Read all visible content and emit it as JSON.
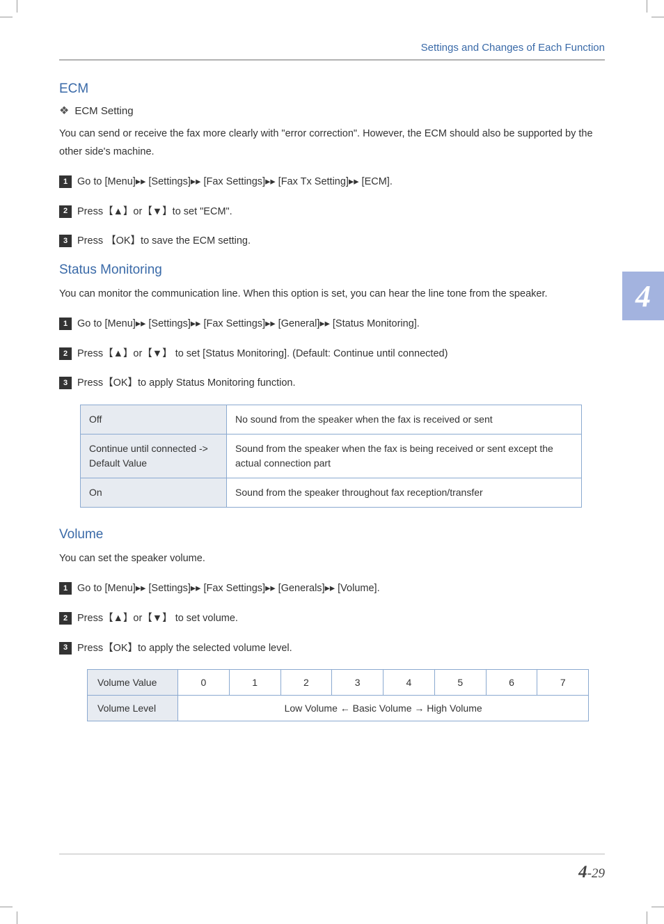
{
  "header": {
    "running": "Settings and Changes of Each Function"
  },
  "chapter_tab": "4",
  "ecm": {
    "title": "ECM",
    "subhead": "ECM Setting",
    "intro": "You can send or receive the fax more clearly with \"error correction\". However, the ECM should also be supported by the other side's machine.",
    "steps": [
      "Go to [Menu]▸▸  [Settings]▸▸ [Fax Settings]▸▸  [Fax Tx Setting]▸▸ [ECM].",
      "Press【▲】or【▼】to set \"ECM\".",
      "Press 【OK】to save the ECM setting."
    ]
  },
  "status": {
    "title": "Status Monitoring",
    "intro": "You can monitor the communication line. When this option is set, you can hear the line tone from the speaker.",
    "steps": [
      "Go to [Menu]▸▸  [Settings]▸▸  [Fax Settings]▸▸  [General]▸▸ [Status Monitoring].",
      "Press【▲】or【▼】 to set [Status Monitoring]. (Default: Continue until connected)",
      "Press【OK】to apply Status Monitoring function."
    ],
    "table": [
      {
        "opt": "Off",
        "desc": "No sound from the speaker when the fax is received or sent"
      },
      {
        "opt": "Continue until connected -> Default Value",
        "desc": "Sound from the speaker when the fax is being received or sent except the actual connection part"
      },
      {
        "opt": "On",
        "desc": "Sound from the speaker throughout fax reception/transfer"
      }
    ]
  },
  "volume": {
    "title": "Volume",
    "intro": "You can set the speaker volume.",
    "steps": [
      "Go to [Menu]▸▸  [Settings]▸▸  [Fax Settings]▸▸  [Generals]▸▸ [Volume].",
      "Press【▲】or【▼】 to set volume.",
      "Press【OK】to apply the selected volume level."
    ],
    "table": {
      "row1_label": "Volume Value",
      "values": [
        "0",
        "1",
        "2",
        "3",
        "4",
        "5",
        "6",
        "7"
      ],
      "row2_label": "Volume Level",
      "row2_value": "Low Volume   ←   Basic Volume   →   High Volume"
    }
  },
  "footer": {
    "chapter": "4",
    "page": "-29"
  }
}
